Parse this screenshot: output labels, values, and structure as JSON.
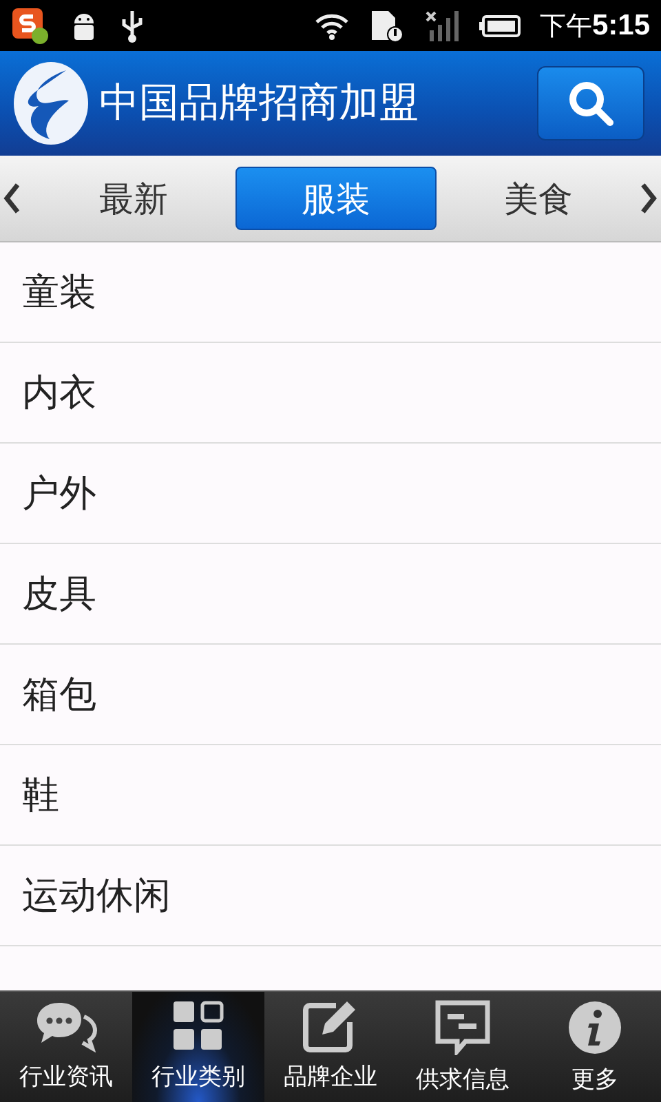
{
  "status_bar": {
    "time_prefix": "下午",
    "time": "5:15"
  },
  "header": {
    "title": "中国品牌招商加盟"
  },
  "tabs": [
    {
      "label": "最新",
      "selected": false
    },
    {
      "label": "服装",
      "selected": true
    },
    {
      "label": "美食",
      "selected": false
    }
  ],
  "list": [
    "童装",
    "内衣",
    "户外",
    "皮具",
    "箱包",
    "鞋",
    "运动休闲"
  ],
  "bottom_nav": [
    {
      "label": "行业资讯",
      "kind": "chat",
      "selected": false
    },
    {
      "label": "行业类别",
      "kind": "grid",
      "selected": true
    },
    {
      "label": "品牌企业",
      "kind": "edit",
      "selected": false
    },
    {
      "label": "供求信息",
      "kind": "message",
      "selected": false
    },
    {
      "label": "更多",
      "kind": "info",
      "selected": false
    }
  ]
}
